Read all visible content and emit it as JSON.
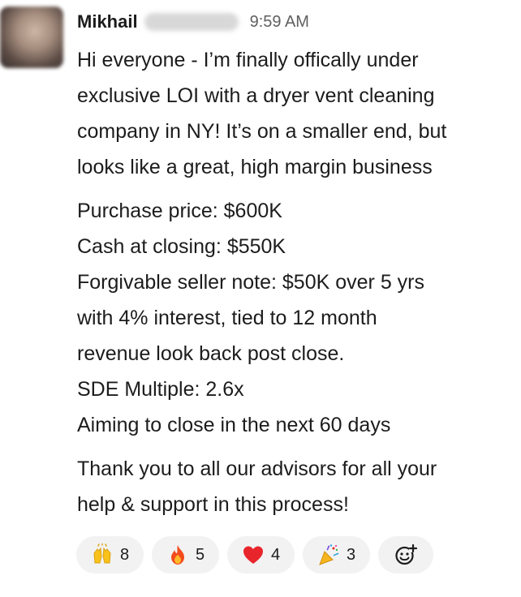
{
  "message": {
    "author": "Mikhail",
    "timestamp": "9:59 AM",
    "paragraphs": [
      [
        "Hi everyone -  I’m finally offically under",
        "exclusive LOI with a dryer vent cleaning",
        "company in NY! It’s on a smaller end, but",
        "looks like a great, high margin business"
      ],
      [
        "Purchase price: $600K",
        "Cash at closing: $550K",
        "Forgivable seller note: $50K over 5 yrs",
        "with 4% interest, tied to 12 month",
        "revenue look back post close.",
        "SDE Multiple: 2.6x",
        "Aiming to close in the next 60 days"
      ],
      [
        "Thank you to all our advisors for all your",
        "help & support in this process!"
      ]
    ]
  },
  "reactions": [
    {
      "icon": "raised-hands-icon",
      "count": "8"
    },
    {
      "icon": "fire-icon",
      "count": "5"
    },
    {
      "icon": "red-heart-icon",
      "count": "4"
    },
    {
      "icon": "party-popper-icon",
      "count": "3"
    }
  ],
  "add_reaction": {
    "icon": "add-reaction-icon"
  }
}
